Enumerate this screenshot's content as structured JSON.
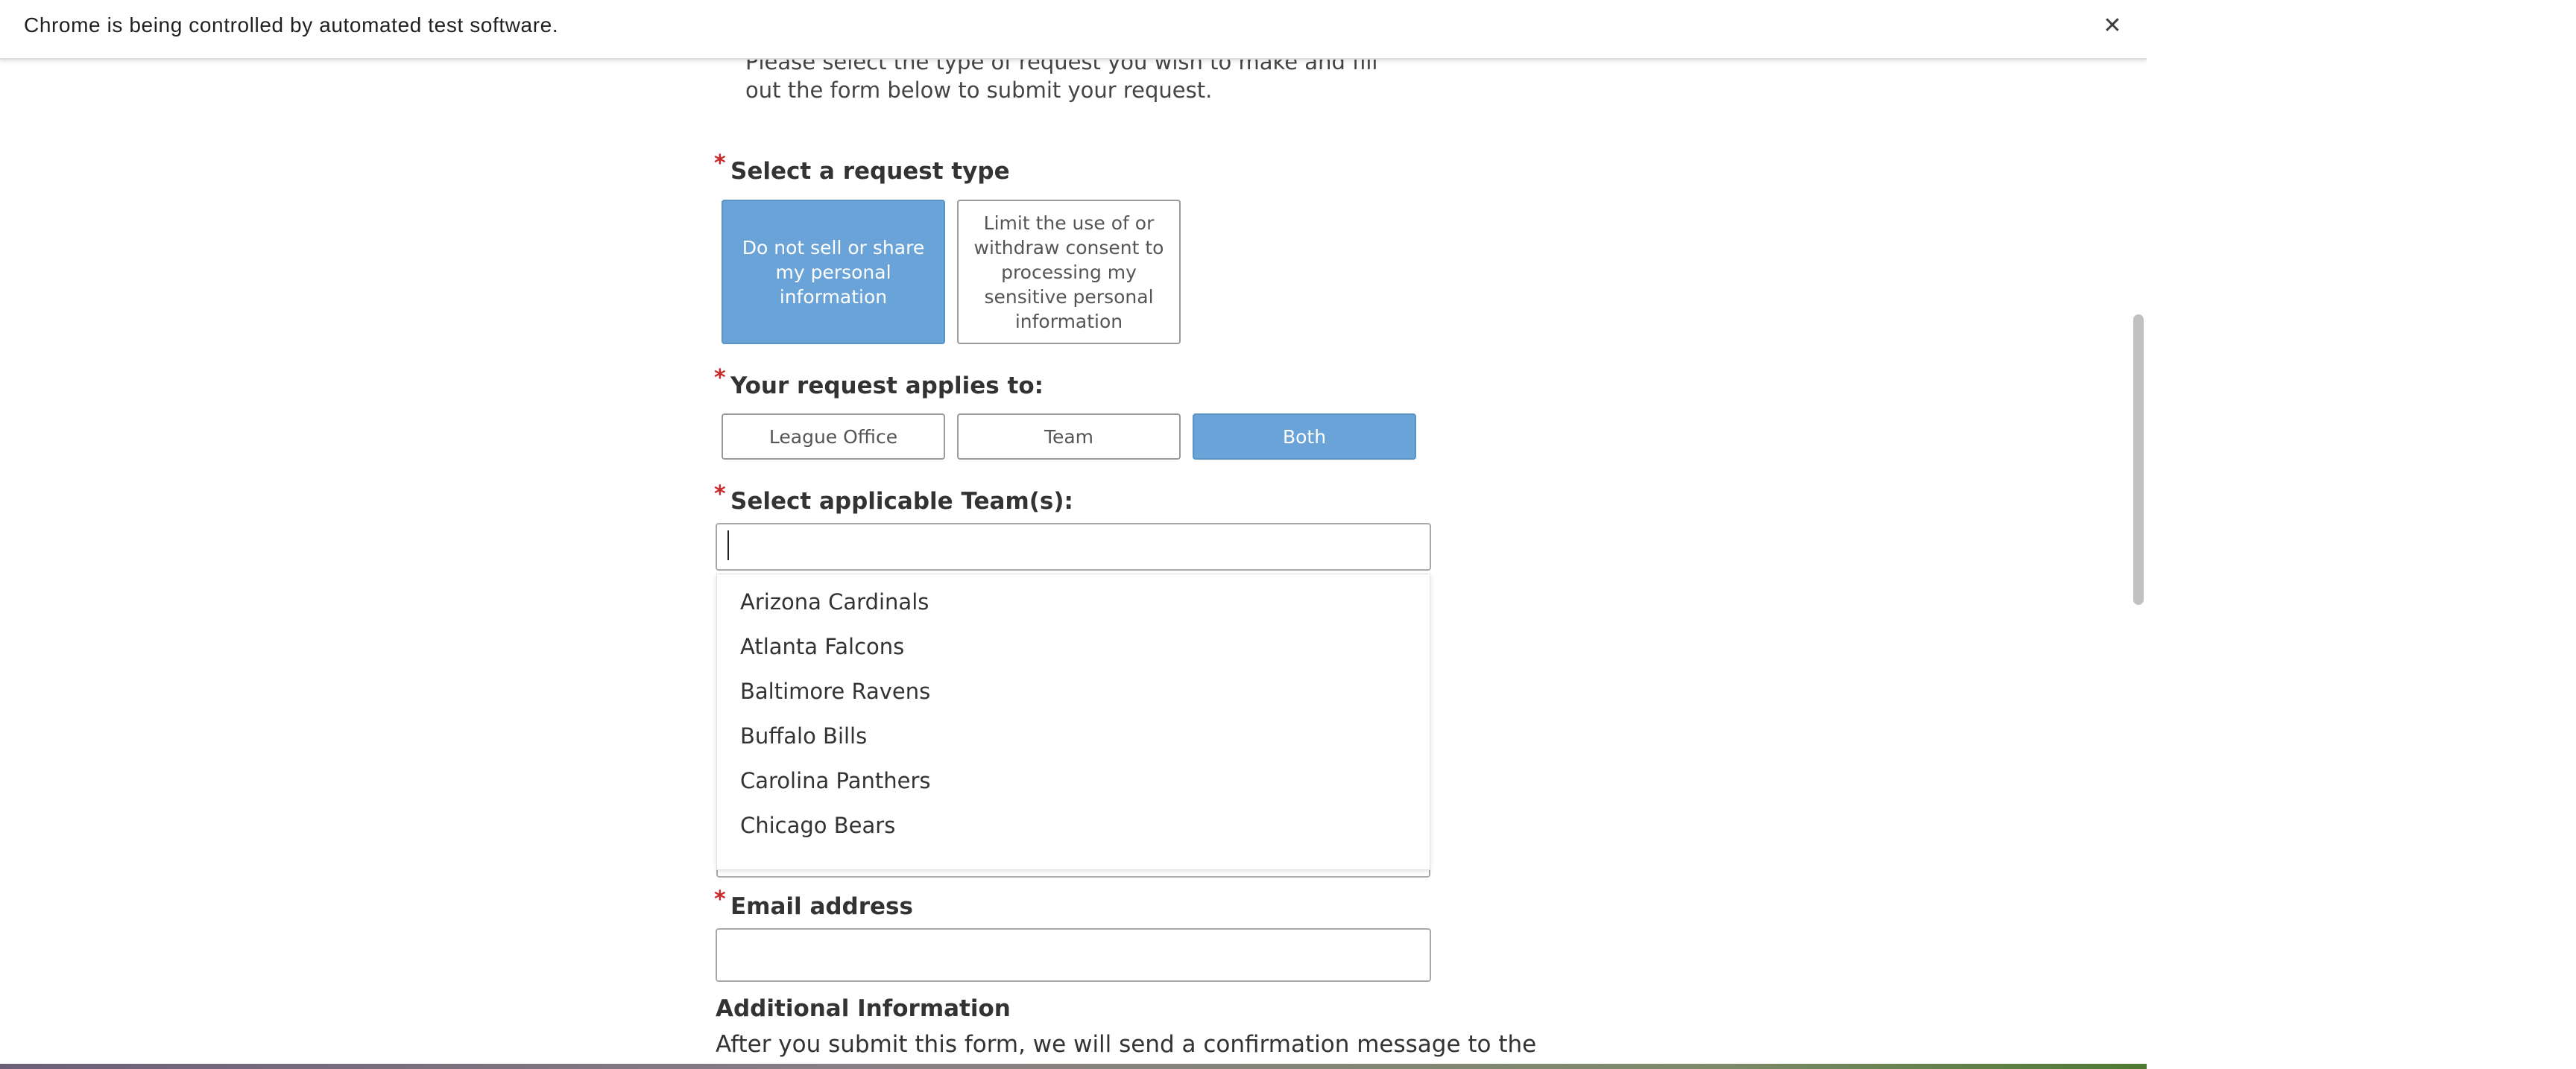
{
  "infobar": {
    "message": "Chrome is being controlled by automated test software.",
    "close_icon": "✕"
  },
  "intro": {
    "text": "Please select the type of request you wish to make and fill out the form below to submit your request."
  },
  "request_type": {
    "required_mark": "*",
    "label": "Select a request type",
    "options": [
      {
        "label": "Do not sell or share my personal information",
        "selected": true
      },
      {
        "label": "Limit the use of or withdraw consent to processing my sensitive personal information",
        "selected": false
      }
    ]
  },
  "applies_to": {
    "required_mark": "*",
    "label": "Your request applies to:",
    "options": [
      {
        "label": "League Office",
        "selected": false
      },
      {
        "label": "Team",
        "selected": false
      },
      {
        "label": "Both",
        "selected": true
      }
    ]
  },
  "teams": {
    "required_mark": "*",
    "label": "Select applicable Team(s):",
    "input_value": "",
    "dropdown_items": [
      "Arizona Cardinals",
      "Atlanta Falcons",
      "Baltimore Ravens",
      "Buffalo Bills",
      "Carolina Panthers",
      "Chicago Bears"
    ]
  },
  "email": {
    "required_mark": "*",
    "label": "Email address",
    "value": ""
  },
  "additional": {
    "title": "Additional Information",
    "text": "After you submit this form, we will send a confirmation message to the"
  },
  "colors": {
    "selected_choice": "#6aa3d8",
    "required_mark": "#cc2a2a"
  }
}
